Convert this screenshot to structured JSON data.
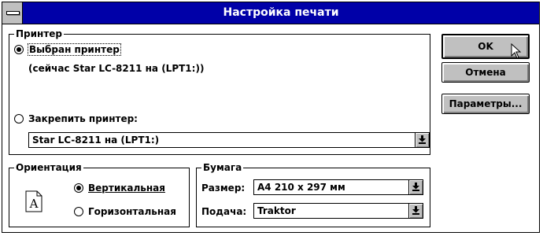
{
  "window": {
    "title": "Настройка печати"
  },
  "printer": {
    "group_label": "Принтер",
    "default_option": "Выбран принтер",
    "current_printer": "(сейчас Star LC-8211 на  (LPT1:))",
    "specific_option": "Закрепить принтер:",
    "specific_value": "Star LC-8211 на  (LPT1:)",
    "selected": "default"
  },
  "orientation": {
    "group_label": "Ориентация",
    "portrait": "Вертикальная",
    "landscape": "Горизонтальная",
    "selected": "portrait",
    "icon_letter": "A"
  },
  "paper": {
    "group_label": "Бумага",
    "size_label": "Размер:",
    "size_value": "A4 210 x 297 мм",
    "source_label": "Подача:",
    "source_value": "Traktor"
  },
  "buttons": {
    "ok": "OK",
    "cancel": "Отмена",
    "options": "Параметры..."
  },
  "colors": {
    "titlebar": "#0000a8",
    "face": "#c0c0c0",
    "shadow": "#808080"
  },
  "icons": {
    "system_menu": "system-menu-icon",
    "dropdown": "down-arrow-icon",
    "page": "portrait-page-icon",
    "cursor": "mouse-pointer-icon"
  }
}
